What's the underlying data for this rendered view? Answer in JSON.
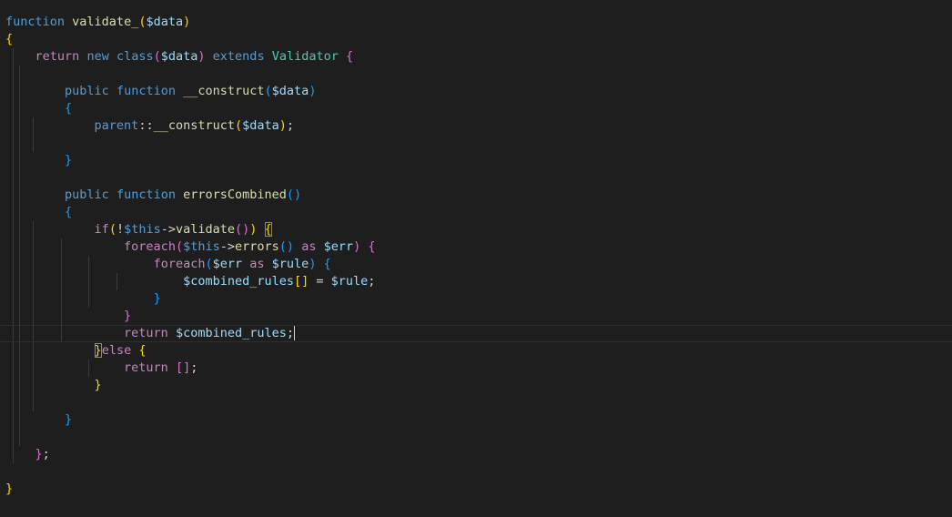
{
  "colors": {
    "background": "#1e1e1e",
    "keyword": "#569cd6",
    "control": "#c586c0",
    "function": "#dcdcaa",
    "variable": "#9cdcfe",
    "class": "#4ec9b0",
    "text": "#d4d4d4",
    "bracket_gold": "#ffd700",
    "bracket_pink": "#da70d6",
    "bracket_blue": "#179fff"
  },
  "current_line_index": 18,
  "lines": [
    [
      {
        "t": "function",
        "c": "keyword"
      },
      {
        "t": " ",
        "c": "text"
      },
      {
        "t": "validate_",
        "c": "function"
      },
      {
        "t": "(",
        "c": "bracket_gold"
      },
      {
        "t": "$data",
        "c": "variable"
      },
      {
        "t": ")",
        "c": "bracket_gold"
      }
    ],
    [
      {
        "t": "{",
        "c": "bracket_gold"
      }
    ],
    [
      {
        "t": "    ",
        "c": "text"
      },
      {
        "t": "return",
        "c": "control"
      },
      {
        "t": " ",
        "c": "text"
      },
      {
        "t": "new",
        "c": "keyword"
      },
      {
        "t": " ",
        "c": "text"
      },
      {
        "t": "class",
        "c": "keyword"
      },
      {
        "t": "(",
        "c": "bracket_pink"
      },
      {
        "t": "$data",
        "c": "variable"
      },
      {
        "t": ")",
        "c": "bracket_pink"
      },
      {
        "t": " ",
        "c": "text"
      },
      {
        "t": "extends",
        "c": "keyword"
      },
      {
        "t": " ",
        "c": "text"
      },
      {
        "t": "Validator",
        "c": "class"
      },
      {
        "t": " ",
        "c": "text"
      },
      {
        "t": "{",
        "c": "bracket_pink"
      }
    ],
    [],
    [
      {
        "t": "        ",
        "c": "text"
      },
      {
        "t": "public",
        "c": "keyword"
      },
      {
        "t": " ",
        "c": "text"
      },
      {
        "t": "function",
        "c": "keyword"
      },
      {
        "t": " ",
        "c": "text"
      },
      {
        "t": "__construct",
        "c": "function"
      },
      {
        "t": "(",
        "c": "bracket_blue"
      },
      {
        "t": "$data",
        "c": "variable"
      },
      {
        "t": ")",
        "c": "bracket_blue"
      }
    ],
    [
      {
        "t": "        ",
        "c": "text"
      },
      {
        "t": "{",
        "c": "bracket_blue"
      }
    ],
    [
      {
        "t": "            ",
        "c": "text"
      },
      {
        "t": "parent",
        "c": "keyword"
      },
      {
        "t": "::",
        "c": "text"
      },
      {
        "t": "__construct",
        "c": "function"
      },
      {
        "t": "(",
        "c": "bracket_gold"
      },
      {
        "t": "$data",
        "c": "variable"
      },
      {
        "t": ")",
        "c": "bracket_gold"
      },
      {
        "t": ";",
        "c": "text"
      }
    ],
    [],
    [
      {
        "t": "        ",
        "c": "text"
      },
      {
        "t": "}",
        "c": "bracket_blue"
      }
    ],
    [],
    [
      {
        "t": "        ",
        "c": "text"
      },
      {
        "t": "public",
        "c": "keyword"
      },
      {
        "t": " ",
        "c": "text"
      },
      {
        "t": "function",
        "c": "keyword"
      },
      {
        "t": " ",
        "c": "text"
      },
      {
        "t": "errorsCombined",
        "c": "function"
      },
      {
        "t": "()",
        "c": "bracket_blue"
      }
    ],
    [
      {
        "t": "        ",
        "c": "text"
      },
      {
        "t": "{",
        "c": "bracket_blue"
      }
    ],
    [
      {
        "t": "            ",
        "c": "text"
      },
      {
        "t": "if",
        "c": "control"
      },
      {
        "t": "(",
        "c": "bracket_gold"
      },
      {
        "t": "!",
        "c": "text"
      },
      {
        "t": "$this",
        "c": "keyword"
      },
      {
        "t": "->",
        "c": "text"
      },
      {
        "t": "validate",
        "c": "function"
      },
      {
        "t": "()",
        "c": "bracket_pink"
      },
      {
        "t": ")",
        "c": "bracket_gold"
      },
      {
        "t": " ",
        "c": "text"
      },
      {
        "t": "{",
        "c": "bracket_gold",
        "m": true
      }
    ],
    [
      {
        "t": "                ",
        "c": "text"
      },
      {
        "t": "foreach",
        "c": "control"
      },
      {
        "t": "(",
        "c": "bracket_pink"
      },
      {
        "t": "$this",
        "c": "keyword"
      },
      {
        "t": "->",
        "c": "text"
      },
      {
        "t": "errors",
        "c": "function"
      },
      {
        "t": "()",
        "c": "bracket_blue"
      },
      {
        "t": " ",
        "c": "text"
      },
      {
        "t": "as",
        "c": "control"
      },
      {
        "t": " ",
        "c": "text"
      },
      {
        "t": "$err",
        "c": "variable"
      },
      {
        "t": ")",
        "c": "bracket_pink"
      },
      {
        "t": " ",
        "c": "text"
      },
      {
        "t": "{",
        "c": "bracket_pink"
      }
    ],
    [
      {
        "t": "                    ",
        "c": "text"
      },
      {
        "t": "foreach",
        "c": "control"
      },
      {
        "t": "(",
        "c": "bracket_blue"
      },
      {
        "t": "$err",
        "c": "variable"
      },
      {
        "t": " ",
        "c": "text"
      },
      {
        "t": "as",
        "c": "control"
      },
      {
        "t": " ",
        "c": "text"
      },
      {
        "t": "$rule",
        "c": "variable"
      },
      {
        "t": ")",
        "c": "bracket_blue"
      },
      {
        "t": " ",
        "c": "text"
      },
      {
        "t": "{",
        "c": "bracket_blue"
      }
    ],
    [
      {
        "t": "                        ",
        "c": "text"
      },
      {
        "t": "$combined_rules",
        "c": "variable"
      },
      {
        "t": "[]",
        "c": "bracket_gold"
      },
      {
        "t": " = ",
        "c": "text"
      },
      {
        "t": "$rule",
        "c": "variable"
      },
      {
        "t": ";",
        "c": "text"
      }
    ],
    [
      {
        "t": "                    ",
        "c": "text"
      },
      {
        "t": "}",
        "c": "bracket_blue"
      }
    ],
    [
      {
        "t": "                ",
        "c": "text"
      },
      {
        "t": "}",
        "c": "bracket_pink"
      }
    ],
    [
      {
        "t": "                ",
        "c": "text"
      },
      {
        "t": "return",
        "c": "control"
      },
      {
        "t": " ",
        "c": "text"
      },
      {
        "t": "$combined_rules",
        "c": "variable"
      },
      {
        "t": ";",
        "c": "text"
      }
    ],
    [
      {
        "t": "            ",
        "c": "text"
      },
      {
        "t": "}",
        "c": "bracket_gold",
        "m": true
      },
      {
        "t": "else",
        "c": "control"
      },
      {
        "t": " ",
        "c": "text"
      },
      {
        "t": "{",
        "c": "bracket_gold"
      }
    ],
    [
      {
        "t": "                ",
        "c": "text"
      },
      {
        "t": "return",
        "c": "control"
      },
      {
        "t": " ",
        "c": "text"
      },
      {
        "t": "[]",
        "c": "bracket_pink"
      },
      {
        "t": ";",
        "c": "text"
      }
    ],
    [
      {
        "t": "            ",
        "c": "text"
      },
      {
        "t": "}",
        "c": "bracket_gold"
      }
    ],
    [],
    [
      {
        "t": "        ",
        "c": "text"
      },
      {
        "t": "}",
        "c": "bracket_blue"
      }
    ],
    [],
    [
      {
        "t": "    ",
        "c": "text"
      },
      {
        "t": "}",
        "c": "bracket_pink"
      },
      {
        "t": ";",
        "c": "text"
      }
    ],
    [],
    [
      {
        "t": "}",
        "c": "bracket_gold"
      }
    ]
  ]
}
